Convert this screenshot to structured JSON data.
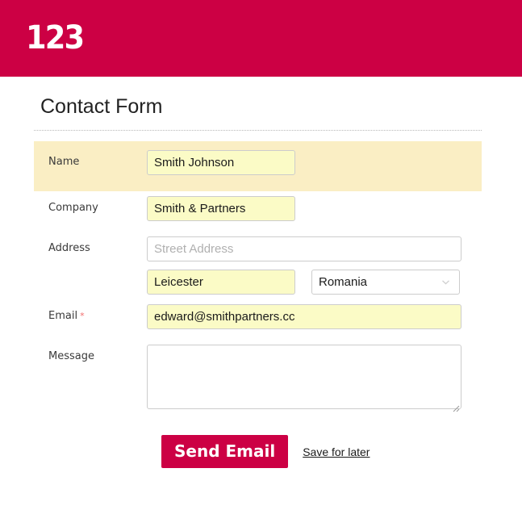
{
  "header": {
    "logo_text": "123",
    "background_color": "#cc0044"
  },
  "page": {
    "title": "Contact Form"
  },
  "form": {
    "rows": [
      {
        "label": "Name",
        "required": false,
        "highlighted": true,
        "value": "Smith Johnson"
      },
      {
        "label": "Company",
        "required": false,
        "highlighted": false,
        "value": "Smith & Partners"
      },
      {
        "label": "Address",
        "required": false,
        "highlighted": false,
        "street_value": "",
        "street_placeholder": "Street Address",
        "city_value": "Leicester",
        "country_value": "Romania",
        "country_icon": "chevron-down-icon"
      },
      {
        "label": "Email",
        "required": true,
        "required_marker": "*",
        "highlighted": false,
        "value": "edward@smithpartners.cc"
      },
      {
        "label": "Message",
        "required": false,
        "highlighted": false,
        "value": "",
        "resize_icon": "resize-grip-icon"
      }
    ]
  },
  "actions": {
    "submit_label": "Send Email",
    "submit_color": "#cc0044",
    "save_link_label": "Save for later"
  }
}
